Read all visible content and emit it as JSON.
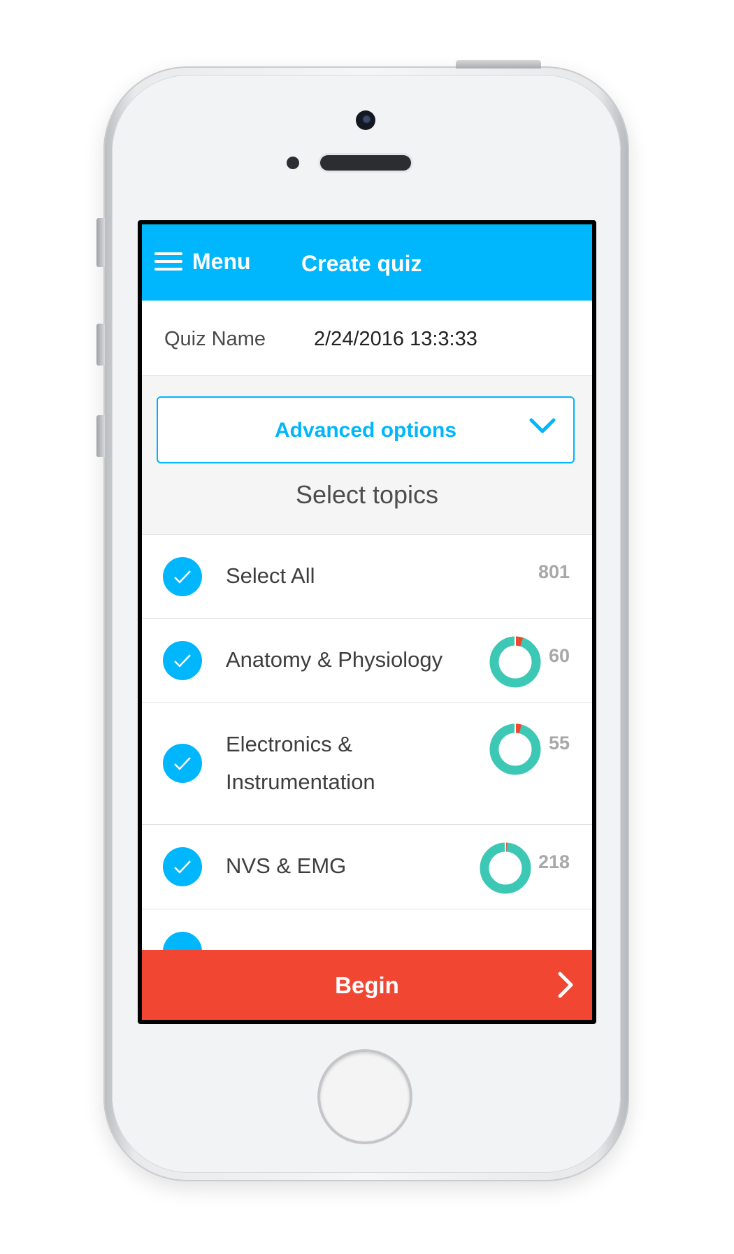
{
  "nav": {
    "menu_label": "Menu",
    "title": "Create quiz"
  },
  "quiz_name": {
    "label": "Quiz Name",
    "value": "2/24/2016 13:3:33"
  },
  "advanced_options": {
    "label": "Advanced options",
    "icon": "chevron-down-icon"
  },
  "topics_section": {
    "title": "Select topics"
  },
  "topics": [
    {
      "label": "Select All",
      "count": "801",
      "checked": true
    },
    {
      "label": "Anatomy & Physiology",
      "count": "60",
      "checked": true,
      "incorrect_fraction": 0.05
    },
    {
      "label_line1": "Electronics &",
      "label_line2": "Instrumentation",
      "count": "55",
      "checked": true,
      "incorrect_fraction": 0.04
    },
    {
      "label": "NVS & EMG",
      "count": "218",
      "checked": true,
      "incorrect_fraction": 0.01
    }
  ],
  "begin": {
    "label": "Begin",
    "icon": "chevron-right-icon"
  },
  "colors": {
    "accent": "#00b6fc",
    "begin": "#f04632",
    "donut_primary": "#3cc8b4",
    "donut_secondary": "#f04632"
  }
}
